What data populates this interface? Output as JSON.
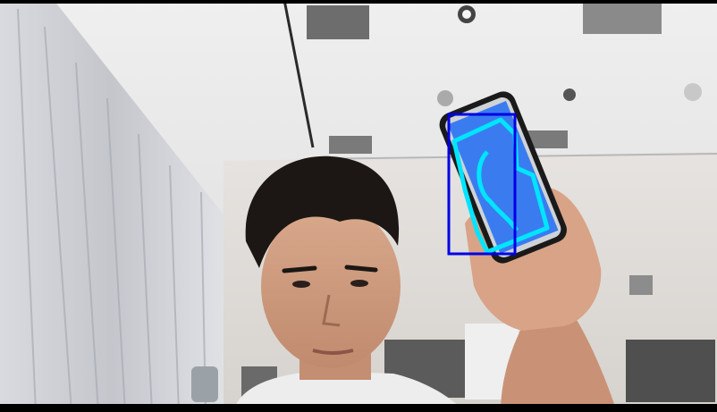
{
  "scene": {
    "kind": "webcam-frame",
    "description_free": true
  },
  "overlays": {
    "bounding_box_color": "#0000e6",
    "contour_color": "#00e5ff",
    "detected_fill_color": "#3a7cf0"
  }
}
